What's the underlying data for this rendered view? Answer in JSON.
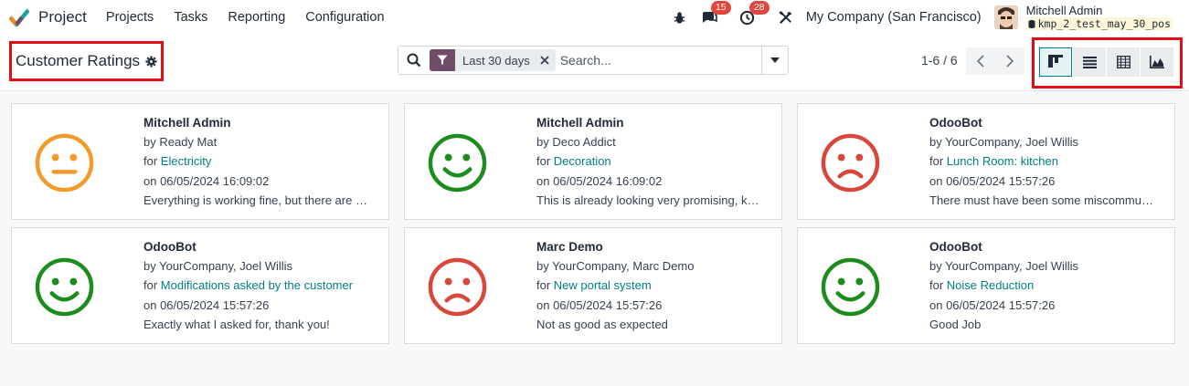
{
  "app": {
    "name": "Project"
  },
  "menu": [
    "Projects",
    "Tasks",
    "Reporting",
    "Configuration"
  ],
  "systray": {
    "messages_count": "15",
    "activities_count": "28",
    "company": "My Company (San Francisco)",
    "user_name": "Mitchell Admin",
    "database": "kmp_2_test_may_30_pos"
  },
  "control": {
    "title": "Customer Ratings",
    "facet_label": "Last 30 days",
    "search_placeholder": "Search...",
    "pager": "1-6 / 6"
  },
  "colors": {
    "accent": "#017e84",
    "brand": "#714b67",
    "ok": "#1c8c1c",
    "neutral": "#f39a2b",
    "bad": "#d9463c",
    "highlight": "#e30d16"
  },
  "ratings": [
    {
      "customer": "Mitchell Admin",
      "partner": "by Ready Mat",
      "for": "for ",
      "task": "Electricity",
      "date": "on 06/05/2024 16:09:02",
      "feedback": "Everything is working fine, but there are some minor issues",
      "mood": "neutral"
    },
    {
      "customer": "Mitchell Admin",
      "partner": "by Deco Addict",
      "for": "for ",
      "task": "Decoration",
      "date": "on 06/05/2024 16:09:02",
      "feedback": "This is already looking very promising, keep going",
      "mood": "happy"
    },
    {
      "customer": "OdooBot",
      "partner": "by YourCompany, Joel Willis",
      "for": "for ",
      "task": "Lunch Room: kitchen",
      "date": "on 06/05/2024 15:57:26",
      "feedback": "There must have been some miscommunication",
      "mood": "sad"
    },
    {
      "customer": "OdooBot",
      "partner": "by YourCompany, Joel Willis",
      "for": "for ",
      "task": "Modifications asked by the customer",
      "date": "on 06/05/2024 15:57:26",
      "feedback": "Exactly what I asked for, thank you!",
      "mood": "happy"
    },
    {
      "customer": "Marc Demo",
      "partner": "by YourCompany, Marc Demo",
      "for": "for ",
      "task": "New portal system",
      "date": "on 06/05/2024 15:57:26",
      "feedback": "Not as good as expected",
      "mood": "sad"
    },
    {
      "customer": "OdooBot",
      "partner": "by YourCompany, Joel Willis",
      "for": "for ",
      "task": "Noise Reduction",
      "date": "on 06/05/2024 15:57:26",
      "feedback": "Good Job",
      "mood": "happy"
    }
  ]
}
